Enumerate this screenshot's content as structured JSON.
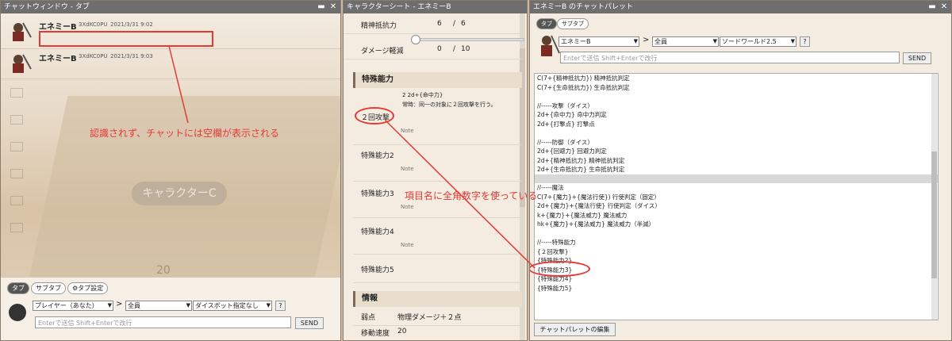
{
  "chat_window": {
    "title": "チャットウィンドウ - タブ",
    "messages": [
      {
        "name": "エネミーB",
        "id": "3XdKC0PU",
        "timestamp": "2021/3/31 9:02",
        "text": ""
      },
      {
        "name": "エネミーB",
        "id": "3XdKC0PU",
        "timestamp": "2021/3/31 9:03",
        "text": ""
      }
    ],
    "board_label": "キャラクターC",
    "board_number": "20",
    "annotation": "認識されず、チャットには空欄が表示される",
    "tabs": {
      "tab": "タブ",
      "subtab": "サブタブ",
      "settings": "タブ設定"
    },
    "sender_select": "プレイヤー（あなた）",
    "target_select": "全員",
    "dice_select": "ダイスボット指定なし",
    "help": "?",
    "input_placeholder": "Enterで送信  Shift+Enterで改行",
    "send": "SEND",
    "gt": ">"
  },
  "sheet": {
    "title": "キャラクターシート - エネミーB",
    "rows": [
      {
        "label": "精神抵抗力",
        "value": "6",
        "sep": "/",
        "max": "6"
      },
      {
        "label": "ダメージ軽減",
        "value": "0",
        "sep": "/",
        "max": "10"
      }
    ],
    "section_abilities": "特殊能力",
    "abilities": [
      {
        "name": "２回攻撃",
        "desc1": "2 2d+{命中力}",
        "desc2": "常時：同一の対象に２回攻撃を行う。",
        "note": "Note"
      },
      {
        "name": "特殊能力2",
        "note": "Note"
      },
      {
        "name": "特殊能力3",
        "note": "Note"
      },
      {
        "name": "特殊能力4",
        "note": "Note"
      },
      {
        "name": "特殊能力5",
        "note": ""
      }
    ],
    "section_info": "情報",
    "info": [
      {
        "label": "弱点",
        "value": "物理ダメージ＋２点"
      },
      {
        "label": "移動速度",
        "value": "20"
      }
    ],
    "annotation": "項目名に全角数字を使っている"
  },
  "palette": {
    "title": "エネミーB のチャットパレット",
    "tab": "タブ",
    "subtab": "サブタブ",
    "character_select": "エネミーB",
    "gt": ">",
    "target_select": "全員",
    "system_select": "ソードワールド2.5",
    "help": "?",
    "input_placeholder": "Enterで送信  Shift+Enterで改行",
    "send": "SEND",
    "lines": [
      "C(7+{精神抵抗力})  精神抵抗判定",
      "C(7+{生命抵抗力})  生命抵抗判定",
      "",
      "//-----攻撃（ダイス）",
      "2d+{命中力}  命中力判定",
      "2d+{打撃点}  打撃点",
      "",
      "//-----防御（ダイス）",
      "2d+{回避力}  回避力判定",
      "2d+{精神抵抗力}  精神抵抗判定",
      "2d+{生命抵抗力}  生命抵抗判定",
      "",
      "//-----魔法",
      "C(7+{魔力}+{魔法行使})  行使判定（固定）",
      "2d+{魔力}+{魔法行使}  行使判定（ダイス）",
      "k+{魔力}+{魔法威力}  魔法威力",
      "hk+{魔力}+{魔法威力}  魔法威力（半減）",
      "",
      "//-----特殊能力",
      "{２回攻撃}",
      "{特殊能力2}",
      "{特殊能力3}",
      "{特殊能力4}",
      "{特殊能力5}"
    ],
    "edit_button": "チャットパレットの編集"
  },
  "colors": {
    "annotation_red": "#e53935",
    "titlebar": "#6e6e6e"
  }
}
